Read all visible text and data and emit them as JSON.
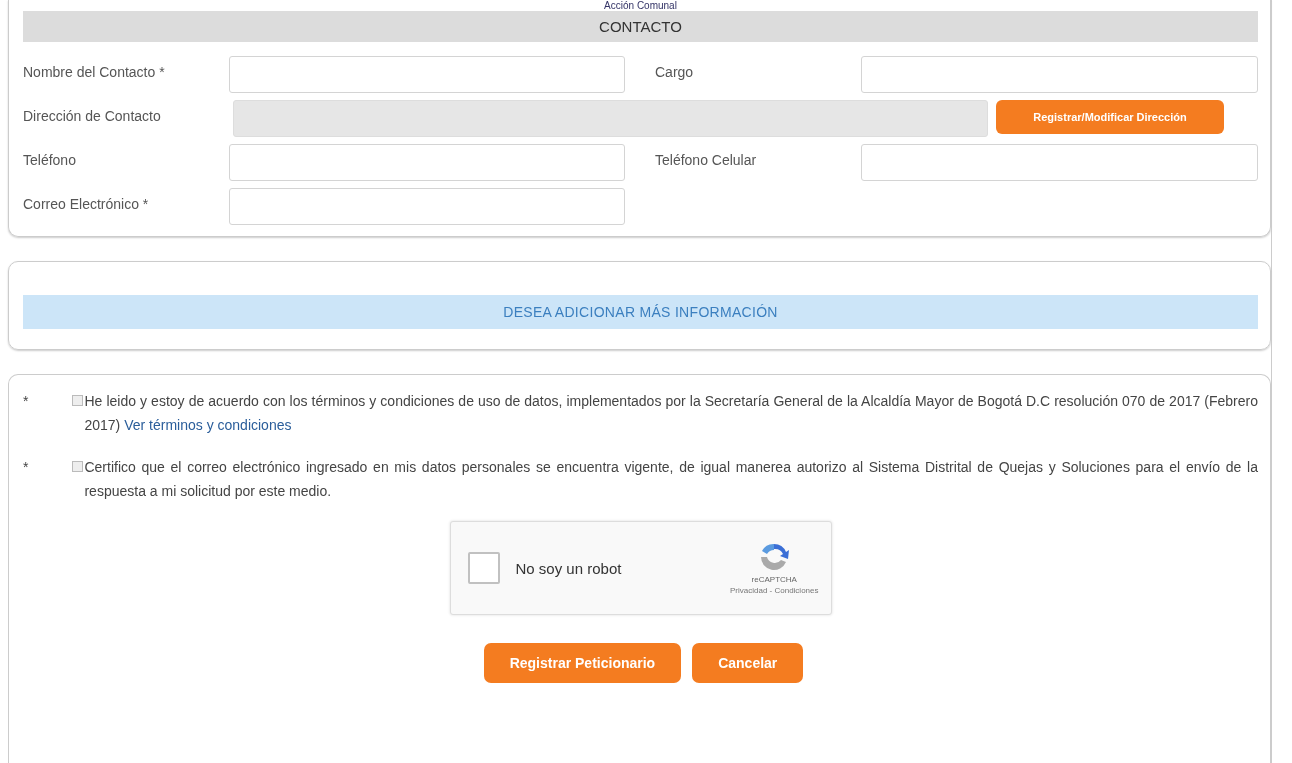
{
  "caption": "Acción Comunal",
  "contact": {
    "title": "CONTACTO",
    "rows": [
      [
        {
          "label": "Nombre del Contacto *",
          "kind": "input"
        },
        {
          "label": "Cargo",
          "kind": "input"
        }
      ],
      [
        {
          "label": "Dirección de Contacto",
          "kind": "readonly",
          "button": "Registrar/Modificar Dirección"
        }
      ],
      [
        {
          "label": "Teléfono",
          "kind": "input"
        },
        {
          "label": "Teléfono Celular",
          "kind": "input"
        }
      ],
      [
        {
          "label": "Correo Electrónico *",
          "kind": "input"
        }
      ]
    ]
  },
  "more_info": {
    "title": "DESEA ADICIONAR MÁS INFORMACIÓN"
  },
  "consents": [
    {
      "mark": "*",
      "checked": false,
      "text": "He leido y estoy de acuerdo con los términos y condiciones de uso de datos, implementados por la Secretaría General de la Alcaldía Mayor de Bogotá D.C resolución 070 de 2017 (Febrero 2017)",
      "link": "Ver términos y condiciones"
    },
    {
      "mark": "*",
      "checked": false,
      "text": "Certifico que el correo electrónico ingresado en mis datos personales se encuentra vigente, de igual manerea autorizo al Sistema Distrital de Quejas y Soluciones para el envío de la respuesta a mi solicitud por este medio."
    }
  ],
  "captcha": {
    "label": "No soy un robot",
    "checked": false,
    "brand": "reCAPTCHA",
    "footer": "Privacidad - Condiciones"
  },
  "buttons": [
    "Registrar Peticionario",
    "Cancelar"
  ]
}
